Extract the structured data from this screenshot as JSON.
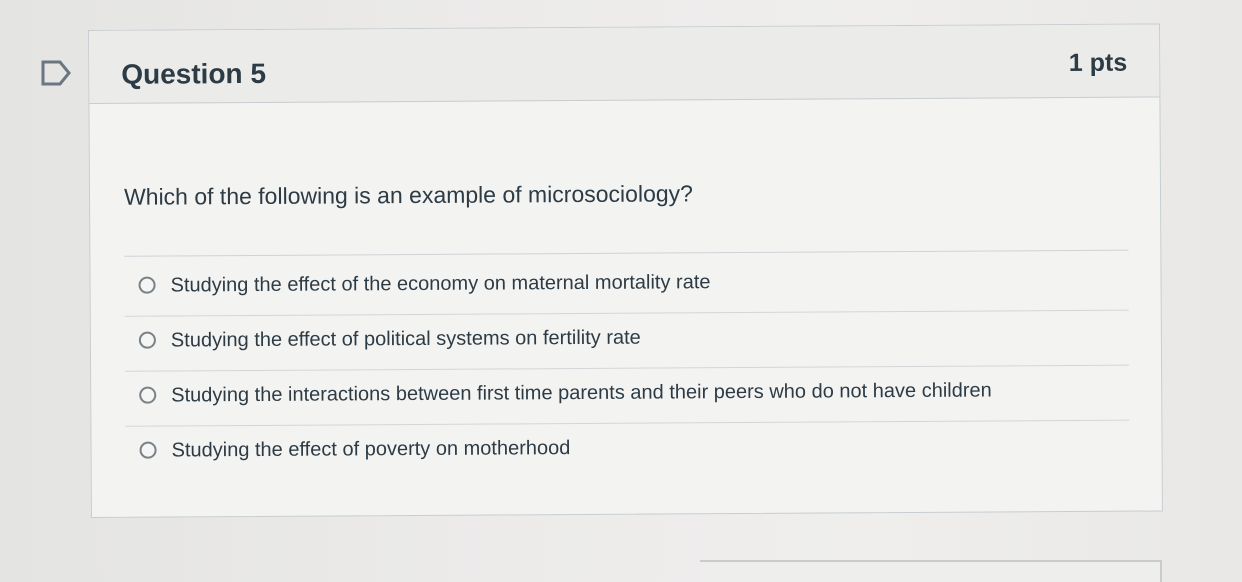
{
  "question": {
    "title": "Question 5",
    "points": "1 pts",
    "text": "Which of the following is an example of microsociology?",
    "flag_icon": "flag-outline-icon"
  },
  "answers": [
    {
      "label": "Studying the effect of the economy on maternal mortality rate",
      "selected": false
    },
    {
      "label": "Studying the effect of political systems on fertility rate",
      "selected": false
    },
    {
      "label": "Studying the interactions between first time parents and their peers who do not have children",
      "selected": false
    },
    {
      "label": "Studying the effect of poverty on motherhood",
      "selected": false
    }
  ],
  "colors": {
    "text": "#2d3b45",
    "border": "#c7cdd1",
    "header_bg": "#ebebea",
    "radio_border": "#7a8288"
  }
}
